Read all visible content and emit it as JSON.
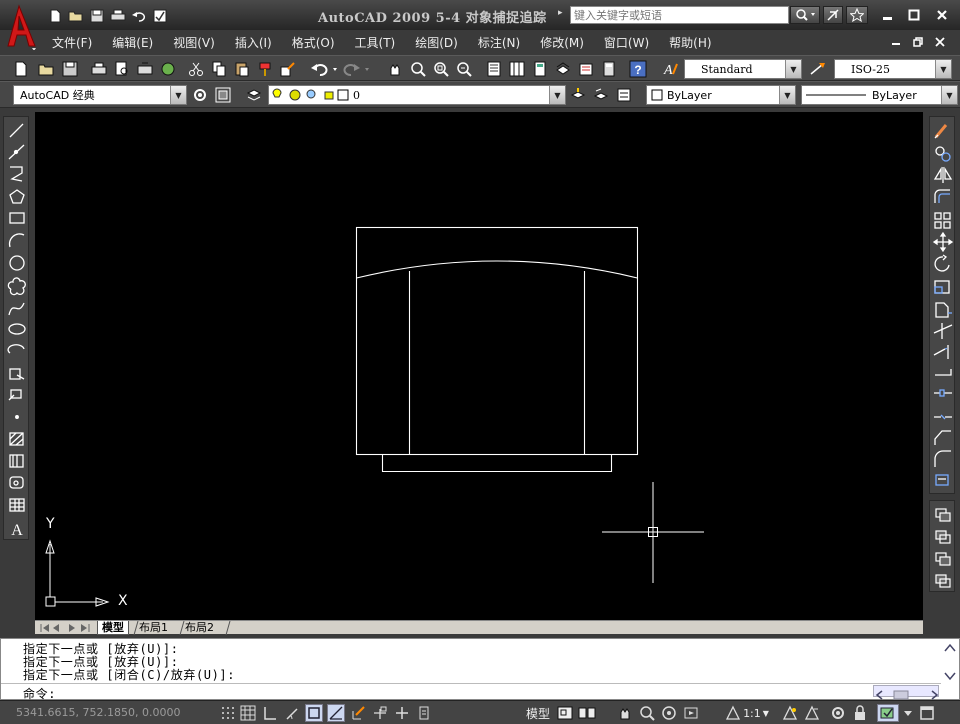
{
  "title": {
    "app": "AutoCAD 2009  5-4  对象捕捉追踪",
    "search_placeholder": "键入关键字或短语"
  },
  "menu": [
    "文件(F)",
    "编辑(E)",
    "视图(V)",
    "插入(I)",
    "格式(O)",
    "工具(T)",
    "绘图(D)",
    "标注(N)",
    "修改(M)",
    "窗口(W)",
    "帮助(H)"
  ],
  "toolbar": {
    "text_style": "Standard",
    "dim_style": "ISO-25",
    "workspace": "AutoCAD 经典",
    "layer": "0",
    "color": "ByLayer",
    "linetype": "ByLayer"
  },
  "canvas": {
    "ucs_x_label": "X",
    "ucs_y_label": "Y",
    "background": "#000000",
    "line_color": "#ffffff"
  },
  "layout_tabs": [
    "模型",
    "布局1",
    "布局2"
  ],
  "command": {
    "history": [
      "指定下一点或 [放弃(U)]:",
      "指定下一点或 [放弃(U)]:",
      "指定下一点或 [闭合(C)/放弃(U)]:"
    ],
    "prompt": "命令:"
  },
  "status": {
    "coordinates": "5341.6615, 752.1850, 0.0000",
    "model_label": "模型",
    "scale": "1:1"
  }
}
